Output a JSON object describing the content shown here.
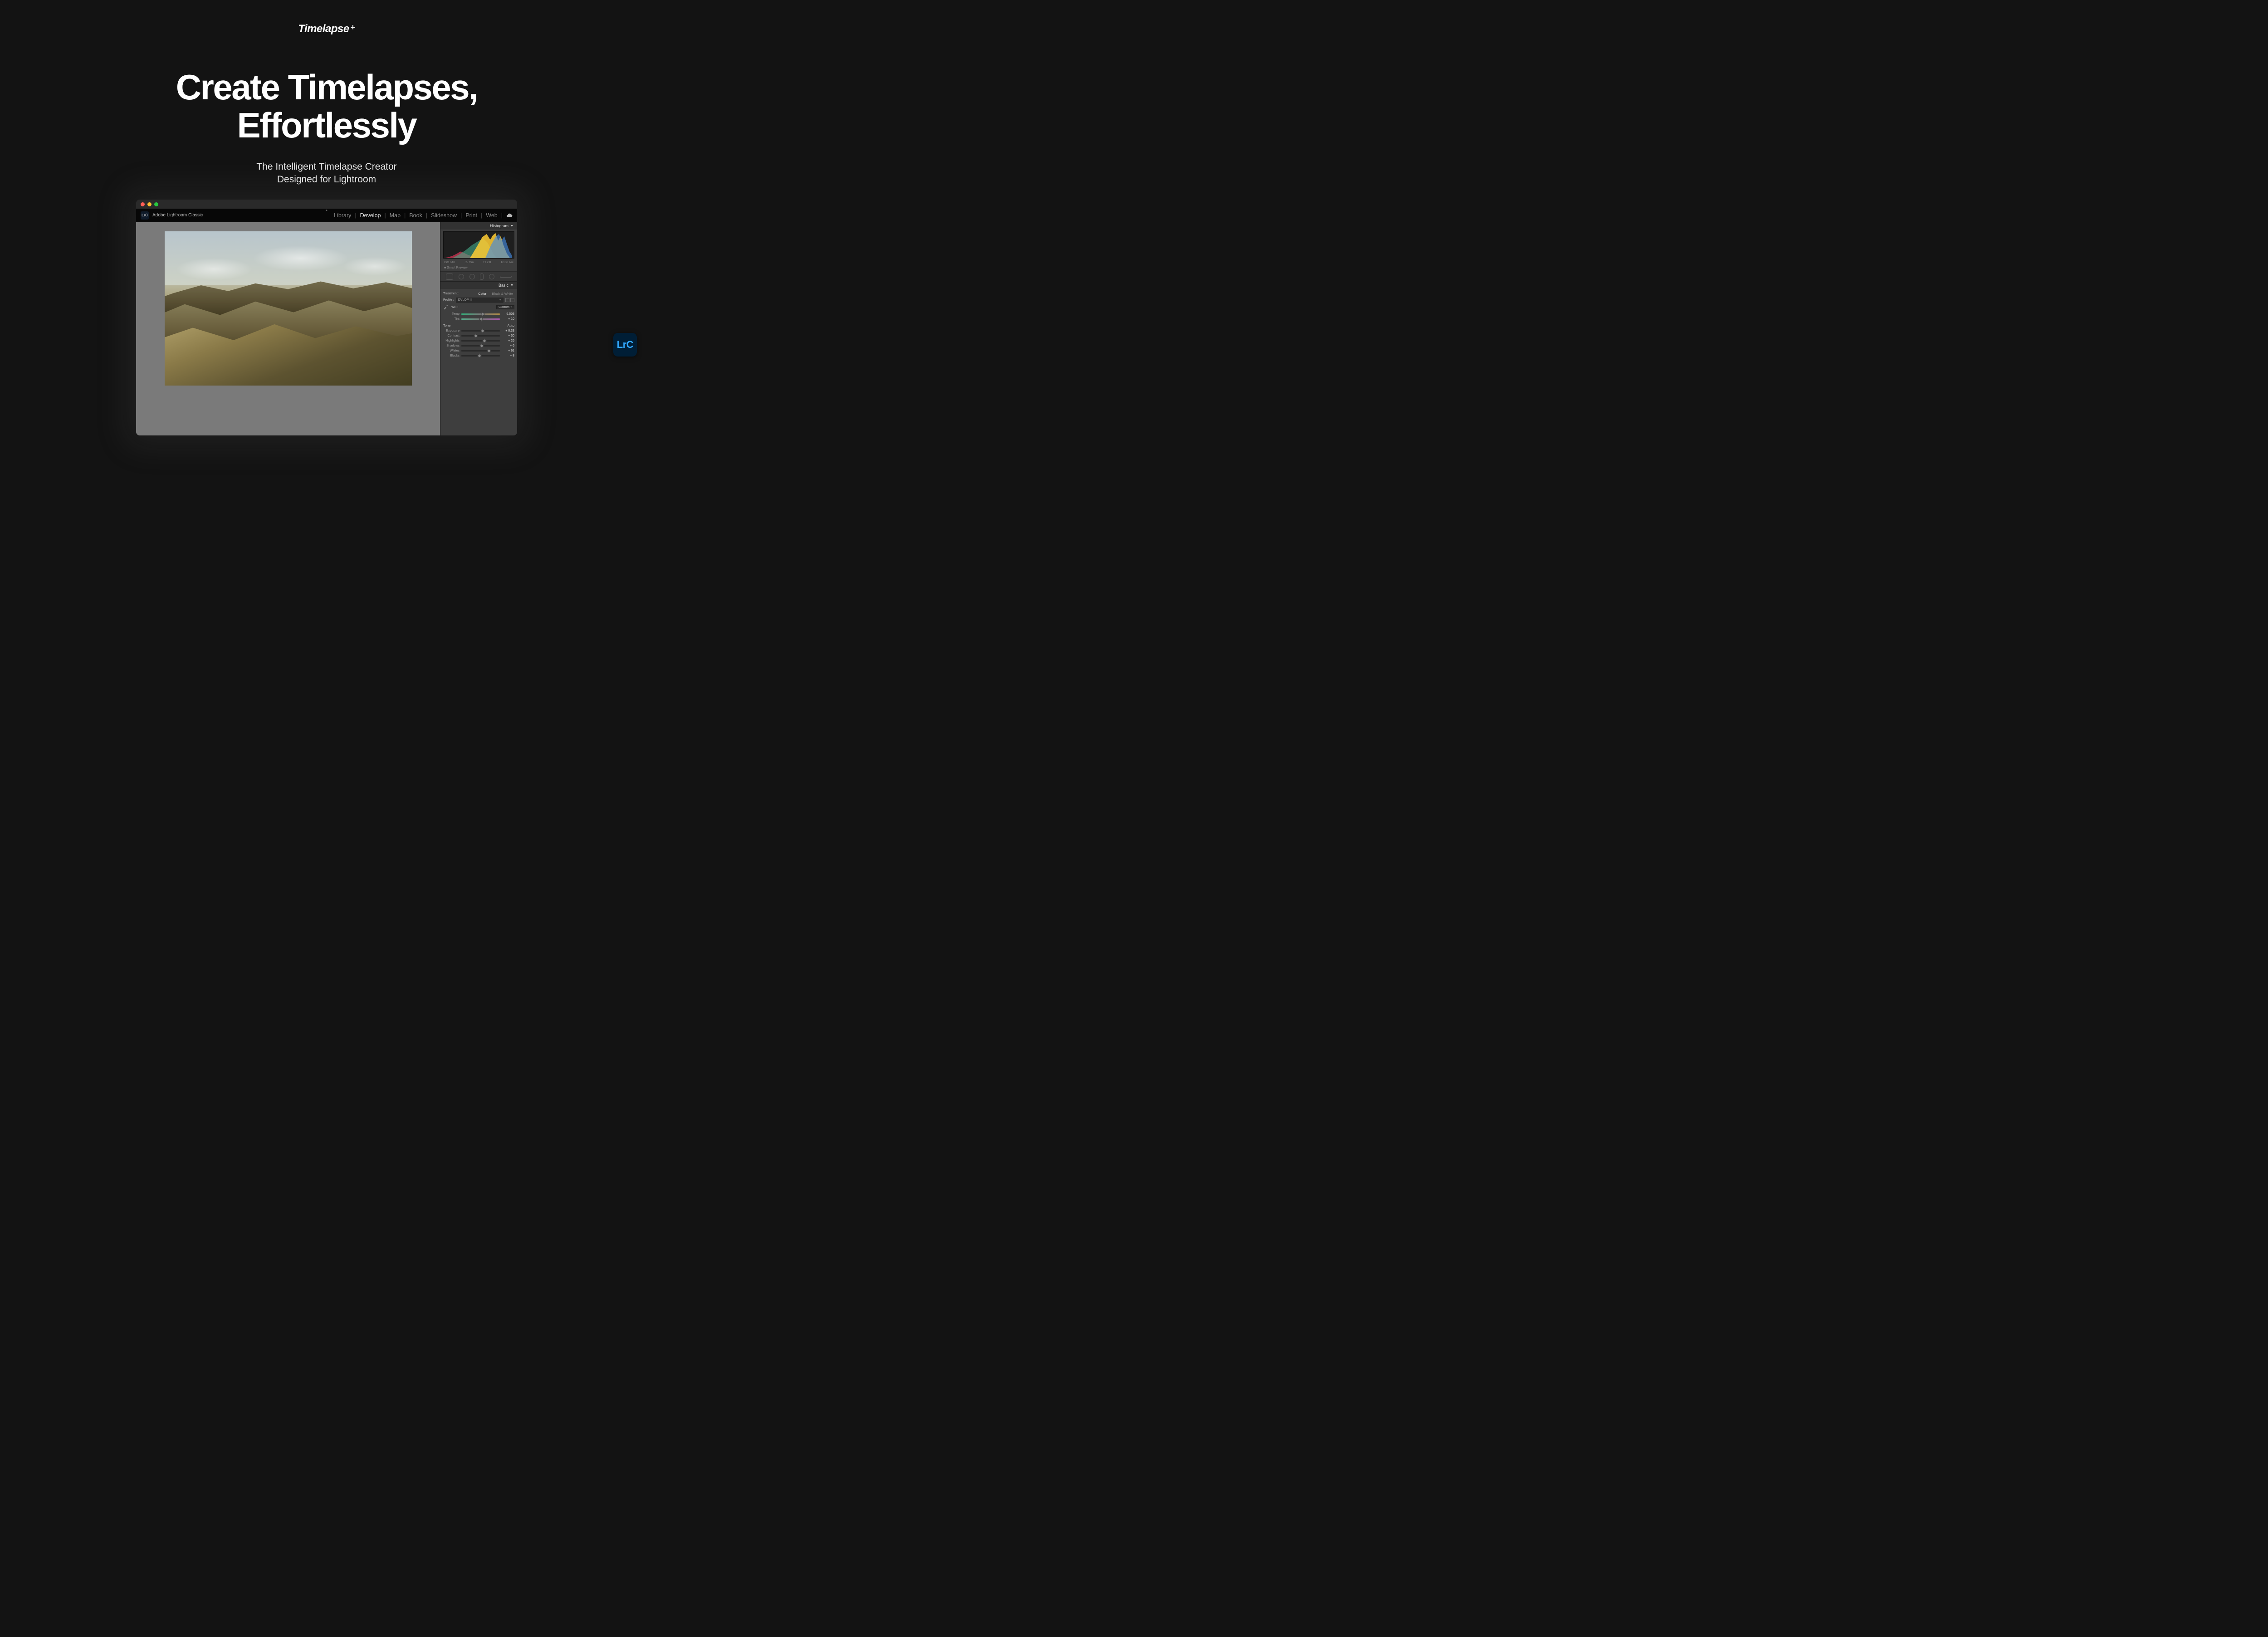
{
  "brand": "Timelapse",
  "headline1": "Create Timelapses,",
  "headline2": "Effortlessly",
  "sub1": "The Intelligent Timelapse Creator",
  "sub2": "Designed for Lightroom",
  "app_title": "Adobe Lightroom Classic",
  "nav": {
    "library": "Library",
    "develop": "Develop",
    "map": "Map",
    "book": "Book",
    "slideshow": "Slideshow",
    "print": "Print",
    "web": "Web"
  },
  "panel": {
    "histogram": "Histogram",
    "iso": "ISO 640",
    "focal": "55 mm",
    "aperture": "f / 2.8",
    "shutter": "1/160 sec",
    "smart_preview": "Smart Preview",
    "basic": "Basic",
    "treatment": "Treatment :",
    "color": "Color",
    "bw": "Black & White",
    "profile": "Profile :",
    "profile_value": "DVLOP III",
    "wb": "WB :",
    "wb_value": "Custom",
    "temp": "Temp",
    "temp_val": "6,503",
    "tint": "Tint",
    "tint_val": "+ 10",
    "tone": "Tone",
    "auto": "Auto",
    "exposure": "Exposure",
    "exposure_val": "+ 0.33",
    "contrast": "Contrast",
    "contrast_val": "− 30",
    "highlights": "Highlights",
    "highlights_val": "+ 26",
    "shadows": "Shadows",
    "shadows_val": "+ 6",
    "whites": "Whites",
    "whites_val": "+ 61",
    "blacks": "Blacks",
    "blacks_val": "− 8"
  },
  "badge": "LrC"
}
